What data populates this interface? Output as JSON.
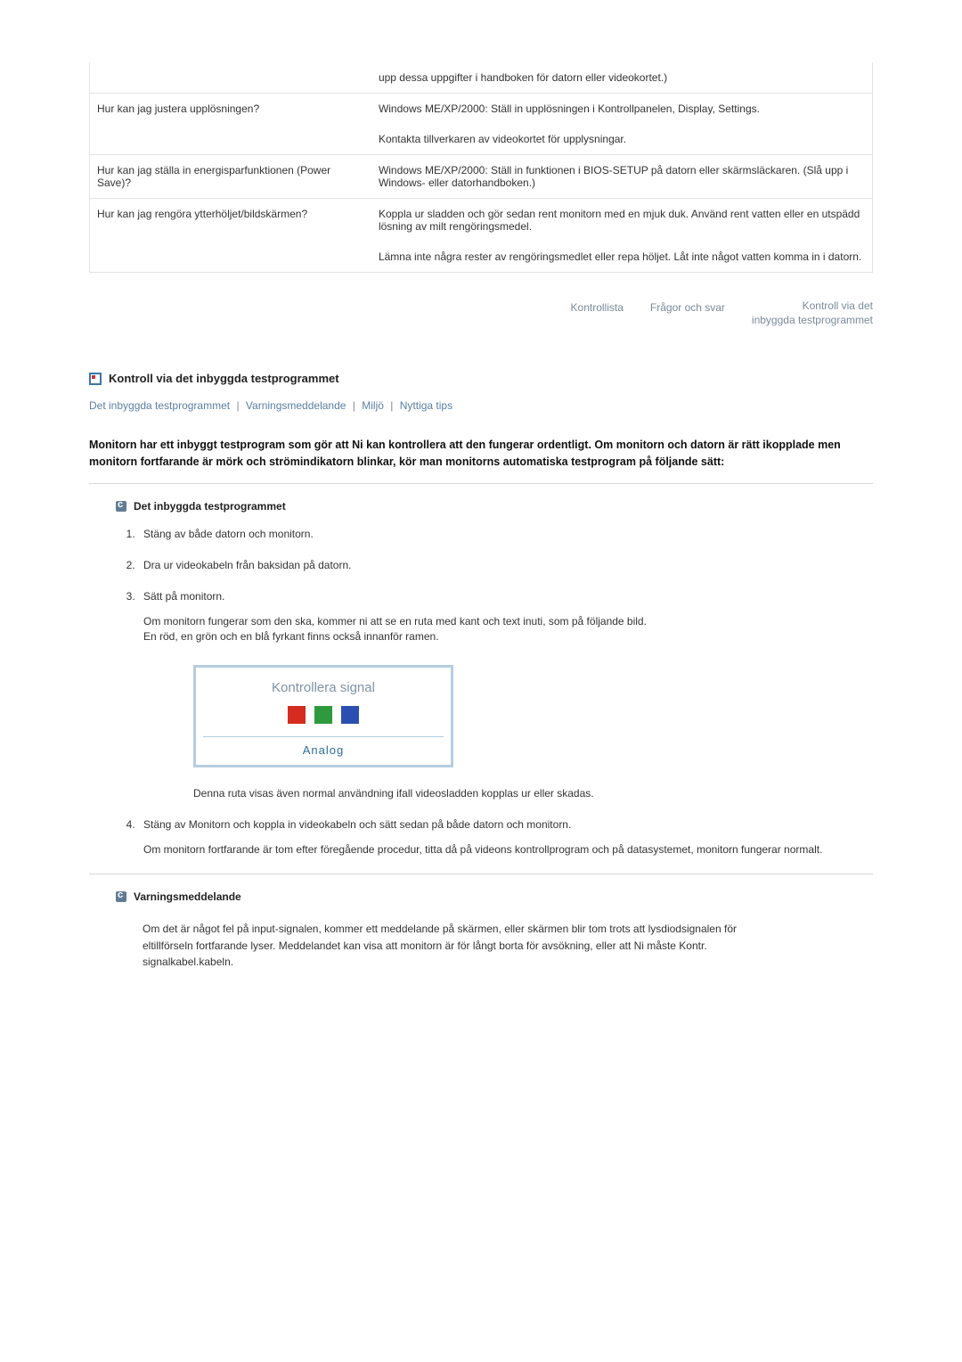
{
  "qa": [
    {
      "q": "",
      "a": "upp dessa uppgifter i handboken för datorn eller videokortet.)"
    },
    {
      "q": "Hur kan jag justera upplösningen?",
      "a": "Windows ME/XP/2000: Ställ in upplösningen i Kontrollpanelen, Display, Settings."
    },
    {
      "q": "",
      "a": "Kontakta tillverkaren av videokortet för upplysningar."
    },
    {
      "q": "Hur kan jag ställa in energisparfunktionen (Power Save)?",
      "a": "Windows ME/XP/2000: Ställ in funktionen i BIOS-SETUP på datorn eller skärmsläckaren. (Slå upp i Windows- eller datorhandboken.)"
    },
    {
      "q": "Hur kan jag rengöra ytterhöljet/bildskärmen?",
      "a": "Koppla ur sladden och gör sedan rent monitorn med en mjuk duk. Använd rent vatten eller en utspädd lösning av milt rengöringsmedel."
    },
    {
      "q": "",
      "a": "Lämna inte några rester av rengöringsmedlet eller repa höljet. Låt inte något vatten komma in i datorn."
    }
  ],
  "subnav": {
    "a": "Kontrollista",
    "b": "Frågor och svar",
    "c1": "Kontroll via det",
    "c2": "inbyggda testprogrammet"
  },
  "sectionTitle": "Kontroll via det inbyggda testprogrammet",
  "links": {
    "a": "Det inbyggda testprogrammet",
    "b": "Varningsmeddelande",
    "c": "Miljö",
    "d": "Nyttiga tips"
  },
  "boldPara": "Monitorn har ett inbyggt testprogram som gör att Ni kan kontrollera att den fungerar ordentligt. Om monitorn och datorn är rätt ikopplade men monitorn fortfarande är mörk och strömindikatorn blinkar, kör man monitorns automatiska testprogram på följande sätt:",
  "sub1": "Det inbyggda testprogrammet",
  "steps": {
    "s1": "Stäng av både datorn och monitorn.",
    "s2": "Dra ur videokabeln från baksidan på datorn.",
    "s3": "Sätt på monitorn.",
    "s3note1": "Om monitorn fungerar som den ska, kommer ni att se en ruta med kant och text inuti, som på följande bild.",
    "s3note2": "En röd, en grön och en blå fyrkant finns också innanför ramen.",
    "boxCaption": "Kontrollera signal",
    "boxBottom": "Analog",
    "afterBox": "Denna ruta visas även normal användning ifall videosladden kopplas ur eller skadas.",
    "s4": "Stäng av Monitorn och koppla in videokabeln och sätt sedan på både datorn och monitorn.",
    "s4note": "Om monitorn fortfarande är tom efter föregående procedur, titta då på videons kontrollprogram och på datasystemet, monitorn fungerar normalt."
  },
  "sub2": "Varningsmeddelande",
  "warn": "Om det är något fel på input-signalen, kommer ett meddelande på skärmen, eller skärmen blir tom trots att lysdiodsignalen för eltillförseln fortfarande lyser. Meddelandet kan visa att monitorn är för långt borta för avsökning, eller att Ni måste Kontr. signalkabel.kabeln."
}
